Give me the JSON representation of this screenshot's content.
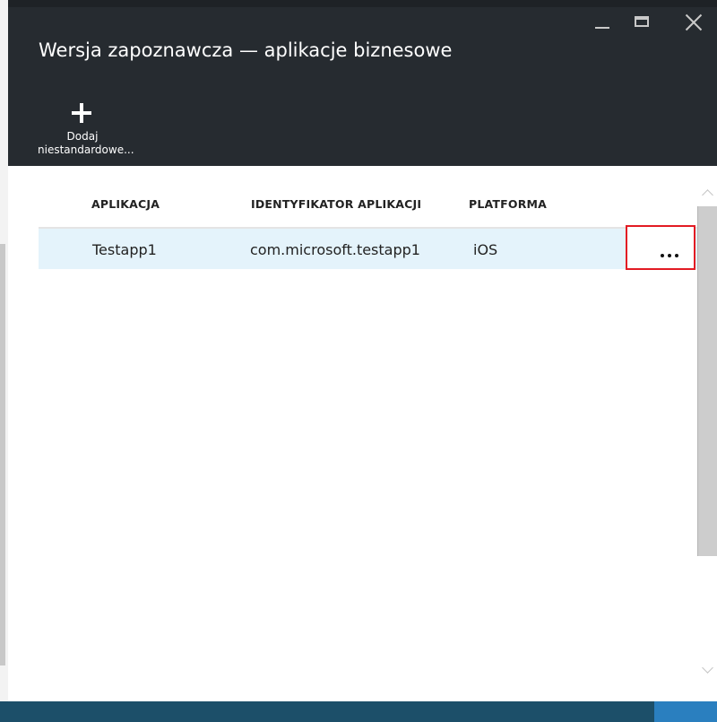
{
  "window": {
    "title": "Wersja zapoznawcza — aplikacje biznesowe"
  },
  "command_bar": {
    "add_custom": {
      "icon": "plus-icon",
      "label_line1": "Dodaj",
      "label_line2": "niestandardowe..."
    }
  },
  "table": {
    "columns": [
      "APLIKACJA",
      "IDENTYFIKATOR APLIKACJI",
      "PLATFORMA"
    ],
    "rows": [
      {
        "app": "Testapp1",
        "app_id": "com.microsoft.testapp1",
        "platform": "iOS",
        "more": "..."
      }
    ]
  },
  "colors": {
    "header_bg": "#262b30",
    "row_selected_bg": "#e4f3fb",
    "highlight_border": "#e21b23",
    "bottom_bar": "#1c4f69"
  }
}
